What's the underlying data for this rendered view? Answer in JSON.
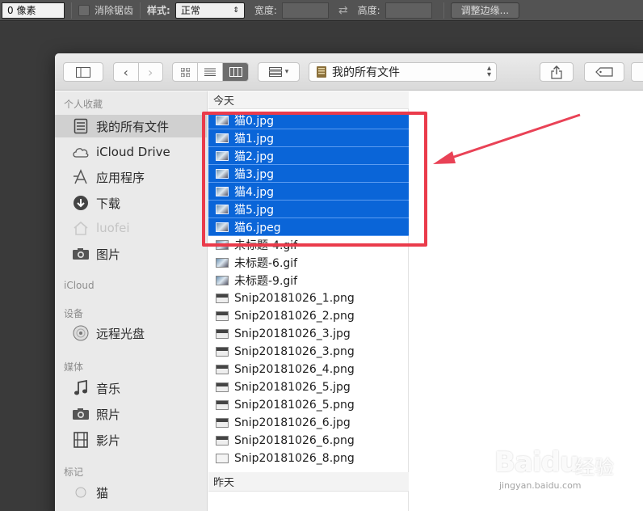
{
  "psbar": {
    "pixel_value": "0 像素",
    "antialias_label": "消除锯齿",
    "style_label": "样式:",
    "style_value": "正常",
    "width_label": "宽度:",
    "height_label": "高度:",
    "refine_button": "调整边缘..."
  },
  "sidebar": {
    "favorites_head": "个人收藏",
    "items": [
      {
        "label": "我的所有文件",
        "icon": "all-files-icon"
      },
      {
        "label": "iCloud Drive",
        "icon": "cloud-icon"
      },
      {
        "label": "应用程序",
        "icon": "applications-icon"
      },
      {
        "label": "下载",
        "icon": "download-icon"
      },
      {
        "label": "luofei",
        "icon": "home-icon"
      },
      {
        "label": "图片",
        "icon": "camera-icon"
      }
    ],
    "icloud_head": "iCloud",
    "devices_head": "设备",
    "devices": [
      {
        "label": "远程光盘",
        "icon": "disc-icon"
      }
    ],
    "media_head": "媒体",
    "media": [
      {
        "label": "音乐",
        "icon": "music-note-icon"
      },
      {
        "label": "照片",
        "icon": "camera-icon"
      },
      {
        "label": "影片",
        "icon": "film-icon"
      }
    ],
    "tags_head": "标记",
    "tags": [
      {
        "label": "猫",
        "icon": "tag-dot-icon"
      }
    ]
  },
  "toolbar": {
    "path_title": "我的所有文件"
  },
  "column": {
    "today_head": "今天",
    "files_selected": [
      "猫0.jpg",
      "猫1.jpg",
      "猫2.jpg",
      "猫3.jpg",
      "猫4.jpg",
      "猫5.jpg",
      "猫6.jpeg"
    ],
    "files_other": [
      "未标题-4.gif",
      "未标题-6.gif",
      "未标题-9.gif",
      "Snip20181026_1.png",
      "Snip20181026_2.png",
      "Snip20181026_3.jpg",
      "Snip20181026_3.png",
      "Snip20181026_4.png",
      "Snip20181026_5.jpg",
      "Snip20181026_5.png",
      "Snip20181026_6.jpg",
      "Snip20181026_6.png",
      "Snip20181026_8.png"
    ],
    "yesterday_head": "昨天"
  },
  "watermark": {
    "brand": "Baidu",
    "cn": "经验",
    "url": "jingyan.baidu.com"
  },
  "colors": {
    "selection": "#0a65d8",
    "highlight_box": "#ea3b4b"
  }
}
